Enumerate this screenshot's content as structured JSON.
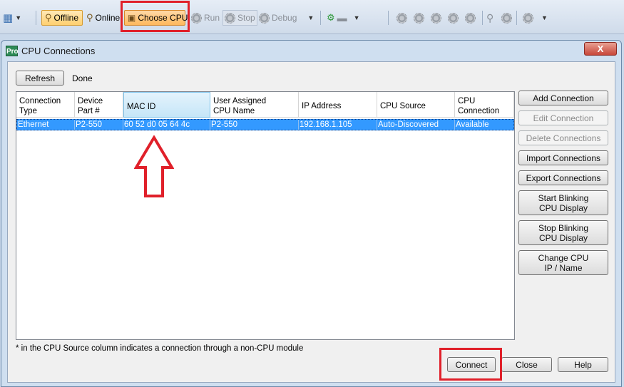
{
  "toolbar": {
    "offline": "Offline",
    "online": "Online",
    "choose_cpu": "Choose CPU",
    "run": "Run",
    "stop": "Stop",
    "debug": "Debug"
  },
  "dialog": {
    "title": "CPU Connections",
    "close_glyph": "X",
    "app_badge": "Pro",
    "refresh": "Refresh",
    "status": "Done",
    "columns": {
      "c1a": "Connection",
      "c1b": "Type",
      "c2a": "Device",
      "c2b": "Part #",
      "c3": "MAC ID",
      "c4a": "User Assigned",
      "c4b": "CPU Name",
      "c5": "IP Address",
      "c6": "CPU Source",
      "c7a": "CPU",
      "c7b": "Connection"
    },
    "row": {
      "type": "Ethernet",
      "part": "P2-550",
      "mac": "60 52 d0 05 64 4c",
      "name": "P2-550",
      "ip": "192.168.1.105",
      "source": "Auto-Discovered",
      "status": "Available"
    },
    "buttons": {
      "add": "Add Connection",
      "edit": "Edit Connection",
      "delete": "Delete Connections",
      "import": "Import Connections",
      "export": "Export Connections",
      "start_a": "Start Blinking",
      "start_b": "CPU Display",
      "stop_a": "Stop Blinking",
      "stop_b": "CPU Display",
      "change_a": "Change CPU",
      "change_b": "IP / Name",
      "connect": "Connect",
      "close": "Close",
      "help": "Help"
    },
    "footnote": "* in the CPU Source column indicates a connection through a non-CPU module"
  },
  "colors": {
    "highlight": "#e0202a",
    "selection": "#3399ff"
  }
}
